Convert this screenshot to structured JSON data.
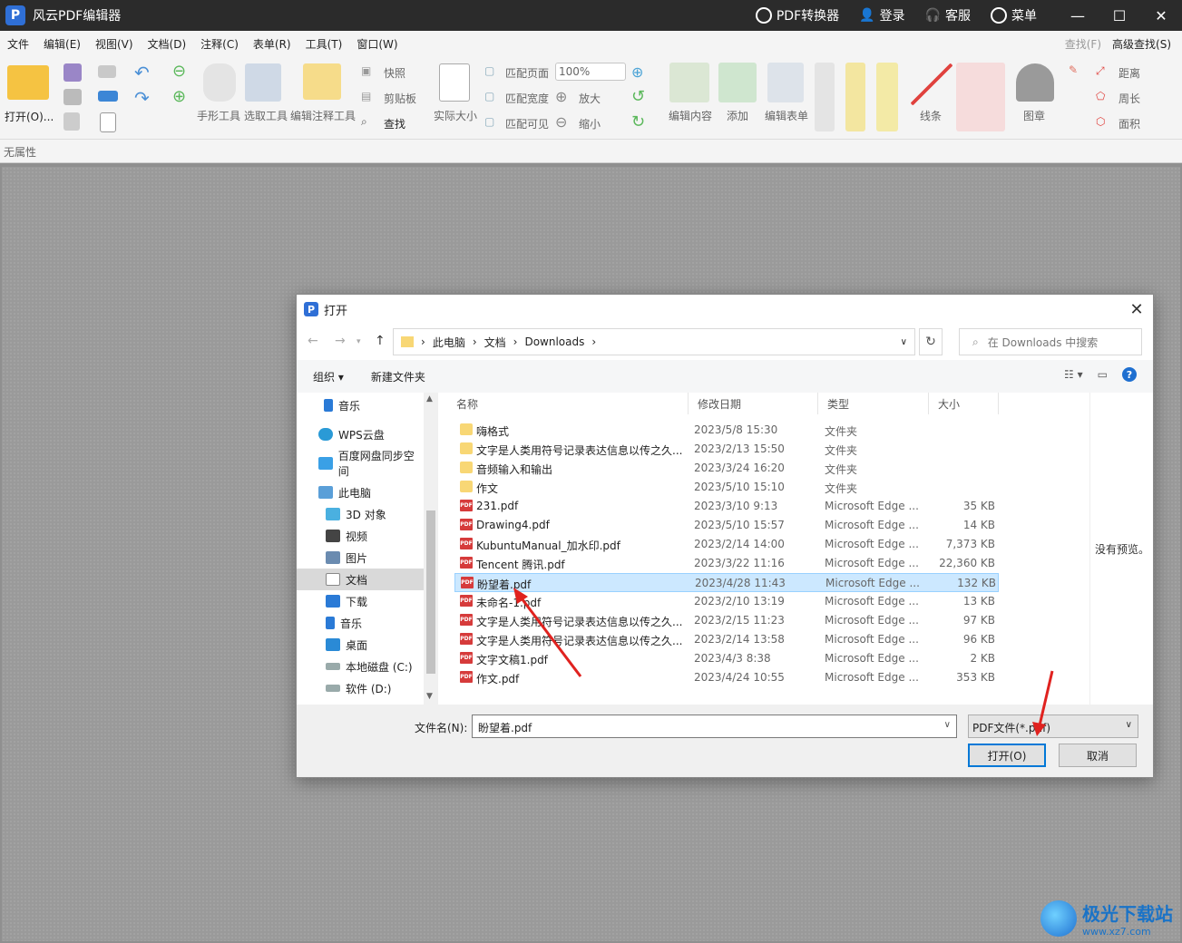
{
  "app": {
    "logo_glyph": "P",
    "title": "风云PDF编辑器",
    "pdf_converter": "PDF转换器",
    "login": "登录",
    "service": "客服",
    "menu": "菜单"
  },
  "menubar": {
    "items": [
      "文件",
      "编辑(E)",
      "视图(V)",
      "文档(D)",
      "注释(C)",
      "表单(R)",
      "工具(T)",
      "窗口(W)"
    ],
    "find": "查找(F)",
    "advanced_find": "高级查找(S)"
  },
  "ribbon": {
    "open": "打开(O)...",
    "snapshot": "快照",
    "clipboard": "剪贴板",
    "find": "查找",
    "hand_tool": "手形工具",
    "select_tool": "选取工具",
    "edit_annotation_tool": "编辑注释工具",
    "actual_size": "实际大小",
    "fit_page": "匹配页面",
    "fit_width": "匹配宽度",
    "fit_visible": "匹配可见",
    "zoom_value": "100%",
    "zoom_in": "放大",
    "zoom_out": "缩小",
    "edit_content": "编辑内容",
    "add": "添加",
    "edit_form": "编辑表单",
    "lines": "线条",
    "stamp": "图章",
    "distance": "距离",
    "perimeter": "周长",
    "area": "面积"
  },
  "propbar": {
    "label": "无属性"
  },
  "dialog": {
    "logo_glyph": "P",
    "title": "打开",
    "close": "✕",
    "breadcrumb": [
      "此电脑",
      "文档",
      "Downloads"
    ],
    "search_placeholder": "在 Downloads 中搜索",
    "organize": "组织 ▾",
    "new_folder": "新建文件夹",
    "help": "?",
    "nav": [
      {
        "label": "音乐",
        "icon": "music-icon"
      },
      {
        "label": "WPS云盘",
        "icon": "cloud-icon"
      },
      {
        "label": "百度网盘同步空间",
        "icon": "baidu-icon"
      },
      {
        "label": "此电脑",
        "icon": "computer-icon"
      },
      {
        "label": "3D 对象",
        "icon": "cube-icon"
      },
      {
        "label": "视频",
        "icon": "video-icon"
      },
      {
        "label": "图片",
        "icon": "picture-icon"
      },
      {
        "label": "文档",
        "icon": "document-icon"
      },
      {
        "label": "下载",
        "icon": "download-icon"
      },
      {
        "label": "音乐",
        "icon": "music-icon"
      },
      {
        "label": "桌面",
        "icon": "desktop-icon"
      },
      {
        "label": "本地磁盘 (C:)",
        "icon": "drive-icon"
      },
      {
        "label": "软件 (D:)",
        "icon": "drive-icon"
      }
    ],
    "columns": [
      "名称",
      "修改日期",
      "类型",
      "大小"
    ],
    "files": [
      {
        "name": "嗨格式",
        "date": "2023/5/8 15:30",
        "type": "文件夹",
        "size": "",
        "kind": "folder"
      },
      {
        "name": "文字是人类用符号记录表达信息以传之久...",
        "date": "2023/2/13 15:50",
        "type": "文件夹",
        "size": "",
        "kind": "folder"
      },
      {
        "name": "音频输入和输出",
        "date": "2023/3/24 16:20",
        "type": "文件夹",
        "size": "",
        "kind": "folder"
      },
      {
        "name": "作文",
        "date": "2023/5/10 15:10",
        "type": "文件夹",
        "size": "",
        "kind": "folder"
      },
      {
        "name": "231.pdf",
        "date": "2023/3/10 9:13",
        "type": "Microsoft Edge ...",
        "size": "35 KB",
        "kind": "pdf"
      },
      {
        "name": "Drawing4.pdf",
        "date": "2023/5/10 15:57",
        "type": "Microsoft Edge ...",
        "size": "14 KB",
        "kind": "pdf"
      },
      {
        "name": "KubuntuManual_加水印.pdf",
        "date": "2023/2/14 14:00",
        "type": "Microsoft Edge ...",
        "size": "7,373 KB",
        "kind": "pdf"
      },
      {
        "name": "Tencent 腾讯.pdf",
        "date": "2023/3/22 11:16",
        "type": "Microsoft Edge ...",
        "size": "22,360 KB",
        "kind": "pdf"
      },
      {
        "name": "盼望着.pdf",
        "date": "2023/4/28 11:43",
        "type": "Microsoft Edge ...",
        "size": "132 KB",
        "kind": "pdf"
      },
      {
        "name": "未命名-1.pdf",
        "date": "2023/2/10 13:19",
        "type": "Microsoft Edge ...",
        "size": "13 KB",
        "kind": "pdf"
      },
      {
        "name": "文字是人类用符号记录表达信息以传之久...",
        "date": "2023/2/15 11:23",
        "type": "Microsoft Edge ...",
        "size": "97 KB",
        "kind": "pdf"
      },
      {
        "name": "文字是人类用符号记录表达信息以传之久...",
        "date": "2023/2/14 13:58",
        "type": "Microsoft Edge ...",
        "size": "96 KB",
        "kind": "pdf"
      },
      {
        "name": "文字文稿1.pdf",
        "date": "2023/4/3 8:38",
        "type": "Microsoft Edge ...",
        "size": "2 KB",
        "kind": "pdf"
      },
      {
        "name": "作文.pdf",
        "date": "2023/4/24 10:55",
        "type": "Microsoft Edge ...",
        "size": "353 KB",
        "kind": "pdf"
      }
    ],
    "pdf_badge": "PDF",
    "preview_text": "没有预览。",
    "filename_label": "文件名(N):",
    "filename_value": "盼望着.pdf",
    "filetype": "PDF文件(*.pdf)",
    "open_button": "打开(O)",
    "cancel_button": "取消"
  },
  "watermark": {
    "name": "极光下载站",
    "url": "www.xz7.com"
  },
  "colors": {
    "accent": "#0078d7",
    "arrow": "#e0221f",
    "selection": "#cce8ff"
  }
}
